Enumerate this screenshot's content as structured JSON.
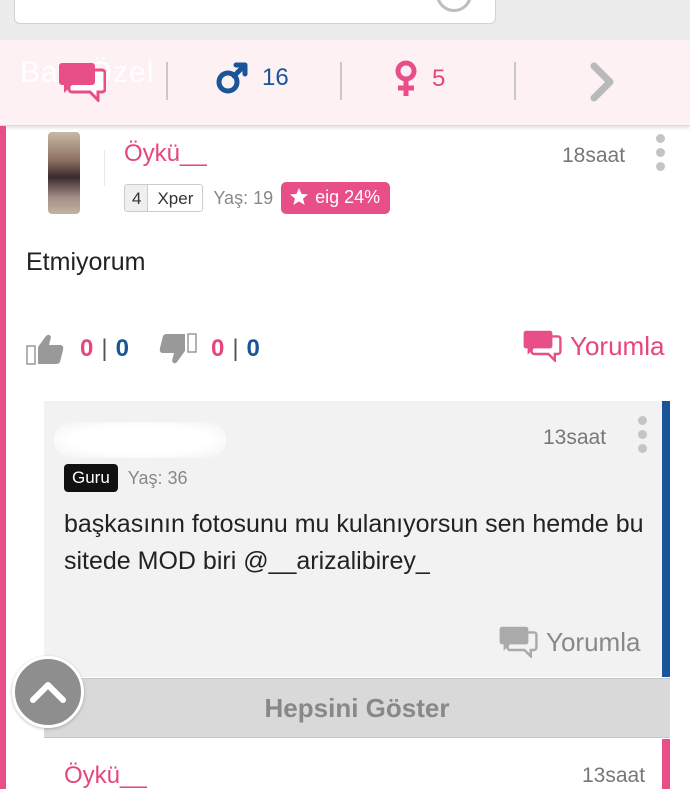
{
  "tabs": {
    "ghost_text_1": "Ba",
    "ghost_text_2": "Özel",
    "male_count": "16",
    "female_count": "5"
  },
  "post": {
    "username": "Öykü__",
    "time": "18saat",
    "level": "4",
    "level_label": "Xper",
    "age": "Yaş: 19",
    "eig_badge": "eig 24%",
    "text": "Etmiyorum",
    "likes_a": "0",
    "likes_b": "0",
    "dislikes_a": "0",
    "dislikes_b": "0",
    "reply_label": "Yorumla"
  },
  "comment": {
    "time": "13saat",
    "rank": "Guru",
    "age": "Yaş: 36",
    "text": "başkasının fotosunu mu kulanıyorsun sen hemde bu sitede MOD biri @__arizalibirey_",
    "reply_label": "Yorumla"
  },
  "show_all_label": "Hepsini Göster",
  "sub_reply": {
    "username": "Öykü__",
    "time": "13saat"
  },
  "colors": {
    "brand_pink": "#e84f88",
    "male_blue": "#1a5499"
  },
  "icons": [
    "chat-bubbles-icon",
    "male-icon",
    "female-icon",
    "chevron-right-icon",
    "more-vertical-icon",
    "thumbs-up-icon",
    "thumbs-down-icon",
    "star-icon",
    "chevron-up-icon"
  ]
}
